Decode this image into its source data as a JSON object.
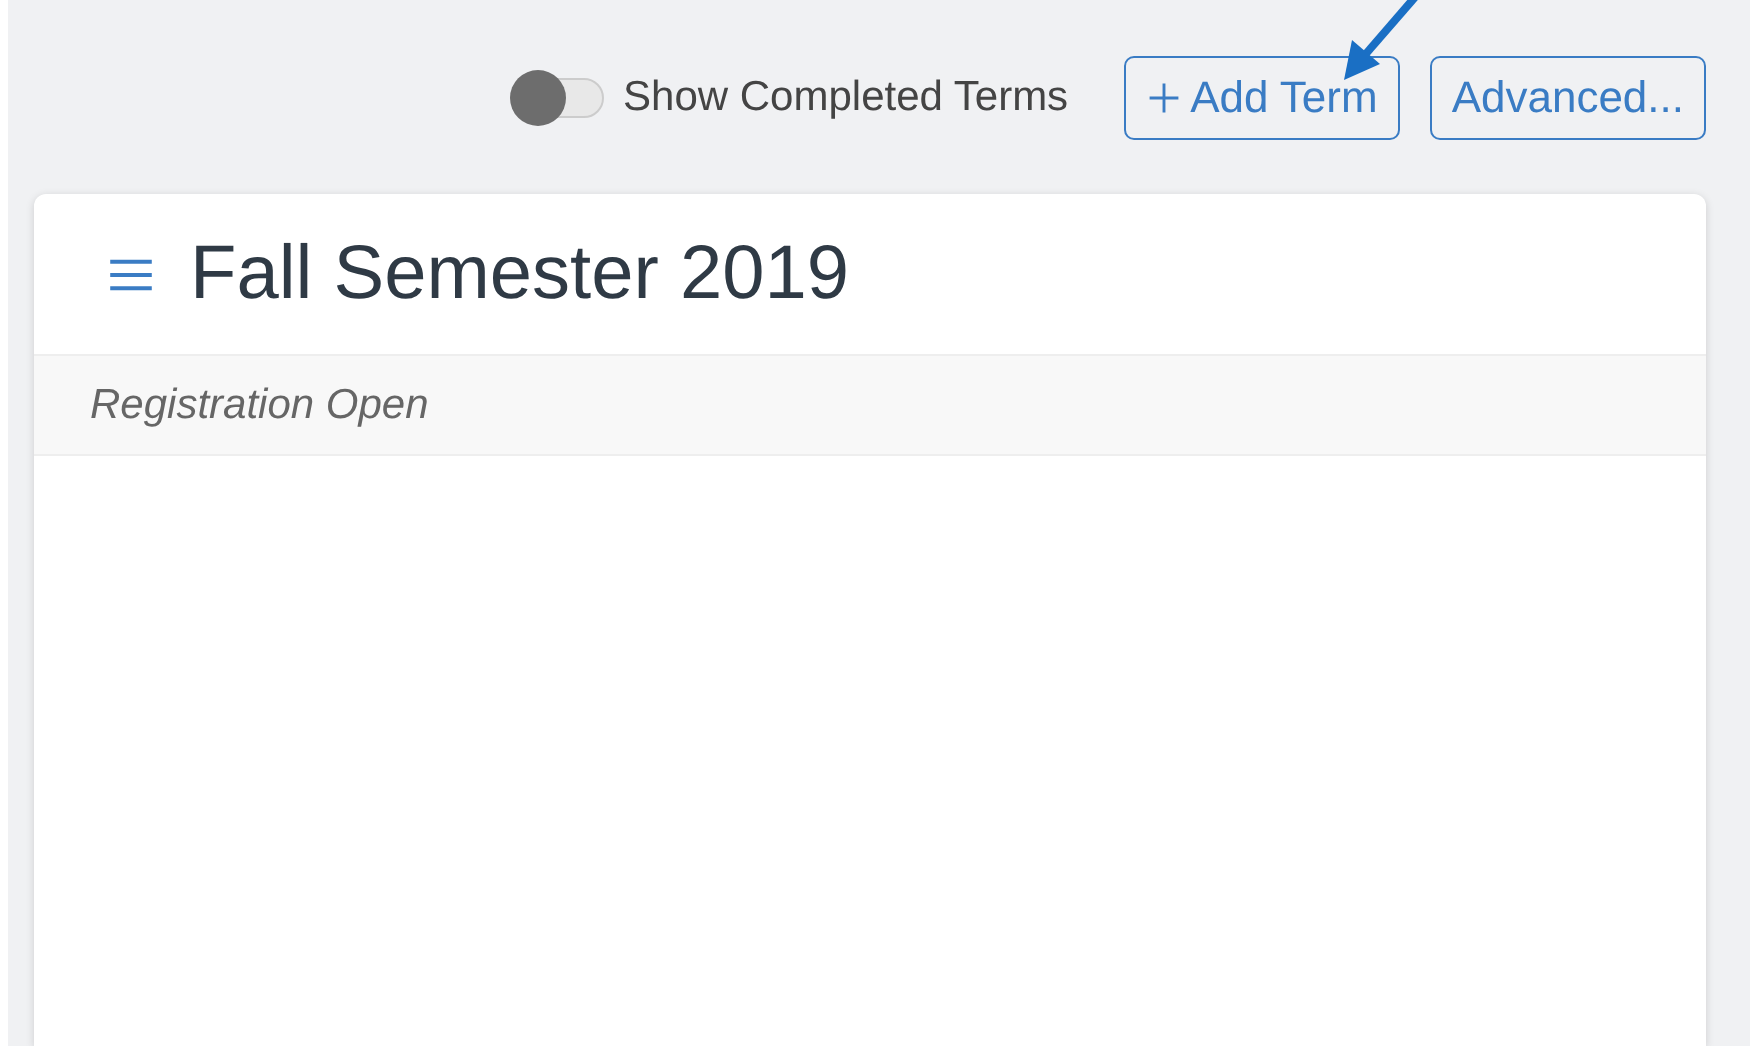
{
  "toolbar": {
    "toggle": {
      "label": "Show Completed Terms",
      "on": false
    },
    "buttons": [
      {
        "label": "Add Term",
        "kind": "add"
      },
      {
        "label": "Advanced...",
        "kind": "plain"
      }
    ]
  },
  "annotation": {
    "kind": "arrow"
  },
  "card": {
    "title": "Fall Semester 2019",
    "status": "Registration Open"
  }
}
